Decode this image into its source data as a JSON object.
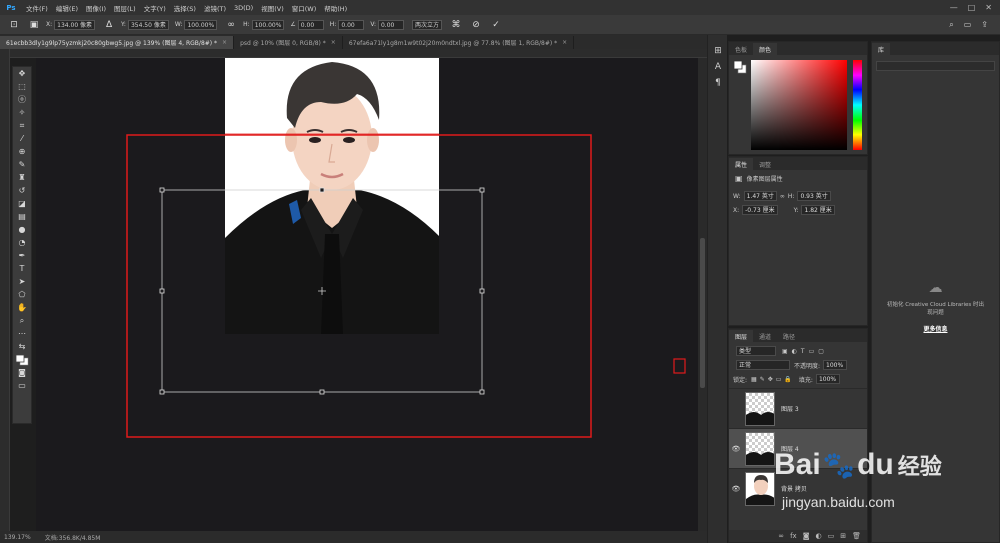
{
  "menu": {
    "logo": "Ps",
    "items": [
      "文件(F)",
      "编辑(E)",
      "图像(I)",
      "图层(L)",
      "文字(Y)",
      "选择(S)",
      "滤镜(T)",
      "3D(D)",
      "视图(V)",
      "窗口(W)",
      "帮助(H)"
    ],
    "window_controls": [
      "—",
      "□",
      "✕"
    ]
  },
  "options": {
    "x_label": "X:",
    "x_value": "134.00 像素",
    "y_label": "Y:",
    "y_value": "354.50 像素",
    "w_label": "W:",
    "w_value": "100.00%",
    "h_label": "H:",
    "h_value": "100.00%",
    "angle_value": "0.00",
    "hskew_label": "H:",
    "hskew_value": "0.00",
    "vskew_label": "V:",
    "vskew_value": "0.00",
    "interp_value": "两次立方"
  },
  "tabs": [
    {
      "label": "61ecbb3dly1g9lp75yzmkj20c80gbwg5.jpg @ 139% (图层 4, RGB/8#) *",
      "active": true
    },
    {
      "label": "psd @ 10% (图层 0, RGB/8) *",
      "active": false
    },
    {
      "label": "67efa6a71ly1g8m1w9t02j20m0ndtxl.jpg @ 77.8% (图层 1, RGB/8#) *",
      "active": false
    }
  ],
  "statusbar": {
    "zoom": "139.17%",
    "doc": "文档:356.8K/4.85M"
  },
  "color_panel": {
    "tabs": [
      "色板",
      "颜色"
    ]
  },
  "props_panel": {
    "tabs": [
      "属性",
      "调整"
    ],
    "title": "像素图层属性",
    "w_label": "W:",
    "w_value": "1.47 英寸",
    "h_label": "H:",
    "h_value": "0.93 英寸",
    "x_label": "X:",
    "x_value": "-0.73 厘米",
    "y_label": "Y:",
    "y_value": "1.82 厘米"
  },
  "layers_panel": {
    "tabs": [
      "图层",
      "通道",
      "路径"
    ],
    "filter_label": "类型",
    "blend_mode": "正常",
    "opacity_label": "不透明度:",
    "opacity_value": "100%",
    "lock_label": "锁定:",
    "fill_label": "填充:",
    "fill_value": "100%",
    "layers": [
      {
        "name": "图层 3",
        "visible": false,
        "selected": false
      },
      {
        "name": "图层 4",
        "visible": true,
        "selected": true
      },
      {
        "name": "背景 拷贝",
        "visible": true,
        "selected": false
      }
    ]
  },
  "lib_panel": {
    "tab": "库",
    "message_line1": "初始化 Creative Cloud Libraries 时出",
    "message_line2": "现问题",
    "more_info": "更多信息"
  },
  "watermark": {
    "brand": "Bai",
    "brand2": "du",
    "cn": "经验",
    "url": "jingyan.baidu.com"
  },
  "colors": {
    "selection_red": "#e01b1b",
    "accent_blue": "#31a8ff"
  }
}
